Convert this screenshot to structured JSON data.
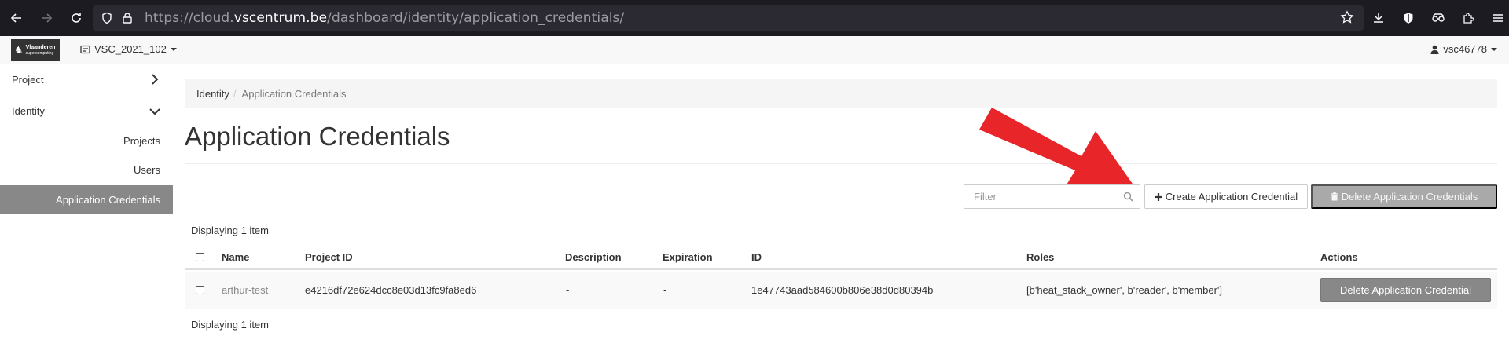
{
  "browser": {
    "url_prefix": "https://cloud.",
    "url_host": "vscentrum.be",
    "url_path": "/dashboard/identity/application_credentials/"
  },
  "navbar": {
    "project": "VSC_2021_102",
    "user": "vsc46778"
  },
  "sidebar": {
    "items": [
      {
        "label": "Project"
      },
      {
        "label": "Identity"
      }
    ],
    "subitems": [
      {
        "label": "Projects"
      },
      {
        "label": "Users"
      },
      {
        "label": "Application Credentials"
      }
    ]
  },
  "breadcrumb": {
    "parent": "Identity",
    "separator": "/",
    "current": "Application Credentials"
  },
  "page": {
    "title": "Application Credentials"
  },
  "toolbar": {
    "filter_placeholder": "Filter",
    "create_label": "Create Application Credential",
    "delete_all_label": "Delete Application Credentials"
  },
  "table": {
    "count_text_top": "Displaying 1 item",
    "count_text_bottom": "Displaying 1 item",
    "columns": [
      "Name",
      "Project ID",
      "Description",
      "Expiration",
      "ID",
      "Roles",
      "Actions"
    ],
    "rows": [
      {
        "name": "arthur-test",
        "project_id": "e4216df72e624dcc8e03d13fc9fa8ed6",
        "description": "-",
        "expiration": "-",
        "id": "1e47743aad584600b806e38d0d80394b",
        "roles": "[b'heat_stack_owner', b'reader', b'member']",
        "action_label": "Delete Application Credential"
      }
    ]
  },
  "colors": {
    "accent_arrow": "#e8262a",
    "active_sidebar": "#888888",
    "disabled_button": "#a9a9a9"
  }
}
